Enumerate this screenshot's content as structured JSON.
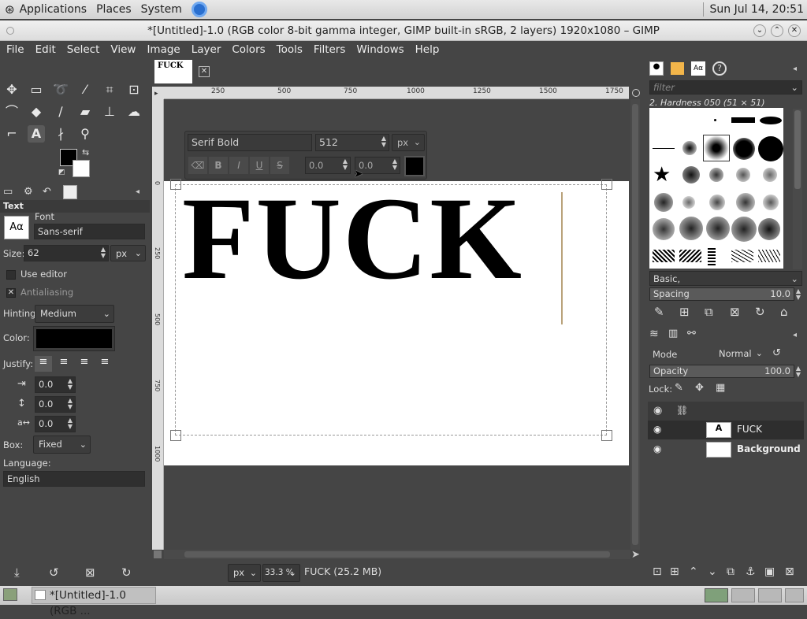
{
  "topbar": {
    "applications": "Applications",
    "places": "Places",
    "system": "System",
    "clock": "Sun Jul 14, 20:51"
  },
  "window": {
    "title": "*[Untitled]-1.0 (RGB color 8-bit gamma integer, GIMP built-in sRGB, 2 layers) 1920x1080 – GIMP"
  },
  "menu": [
    "File",
    "Edit",
    "Select",
    "View",
    "Image",
    "Layer",
    "Colors",
    "Tools",
    "Filters",
    "Windows",
    "Help"
  ],
  "image_tab": {
    "thumb_text": "FUCK"
  },
  "ruler_h": [
    "250",
    "500",
    "750",
    "1000",
    "1250",
    "1500",
    "1750"
  ],
  "ruler_v": [
    "0",
    "250",
    "500",
    "750",
    "1000"
  ],
  "text_toolbar": {
    "font": "Serif Bold",
    "size": "512",
    "unit": "px",
    "baseline": "0.0",
    "kerning": "0.0"
  },
  "canvas": {
    "text": "FUCK"
  },
  "tool_options": {
    "header": "Text",
    "font_label": "Font",
    "font_value": "Sans-serif",
    "size_label": "Size:",
    "size_value": "62",
    "size_unit": "px",
    "use_editor": "Use editor",
    "antialiasing": "Antialiasing",
    "antialias_check": "✕",
    "hinting_label": "Hinting:",
    "hinting_value": "Medium",
    "color_label": "Color:",
    "text_color": "#000000",
    "justify_label": "Justify:",
    "indent": "0.0",
    "line_spacing": "0.0",
    "letter_spacing": "0.0",
    "box_label": "Box:",
    "box_value": "Fixed",
    "language_label": "Language:",
    "language_value": "English"
  },
  "status": {
    "unit": "px",
    "zoom": "33.3 %",
    "info": "FUCK (25.2 MB)"
  },
  "brushes": {
    "filter_placeholder": "filter",
    "current": "2. Hardness 050 (51 × 51)",
    "tag": "Basic,",
    "spacing_label": "Spacing",
    "spacing_value": "10.0"
  },
  "layers": {
    "mode_label": "Mode",
    "mode_value": "Normal",
    "opacity_label": "Opacity",
    "opacity_value": "100.0",
    "lock_label": "Lock:",
    "items": [
      {
        "name": "FUCK"
      },
      {
        "name": "Background"
      }
    ]
  },
  "taskbar": {
    "item": "*[Untitled]-1.0 (RGB ..."
  }
}
